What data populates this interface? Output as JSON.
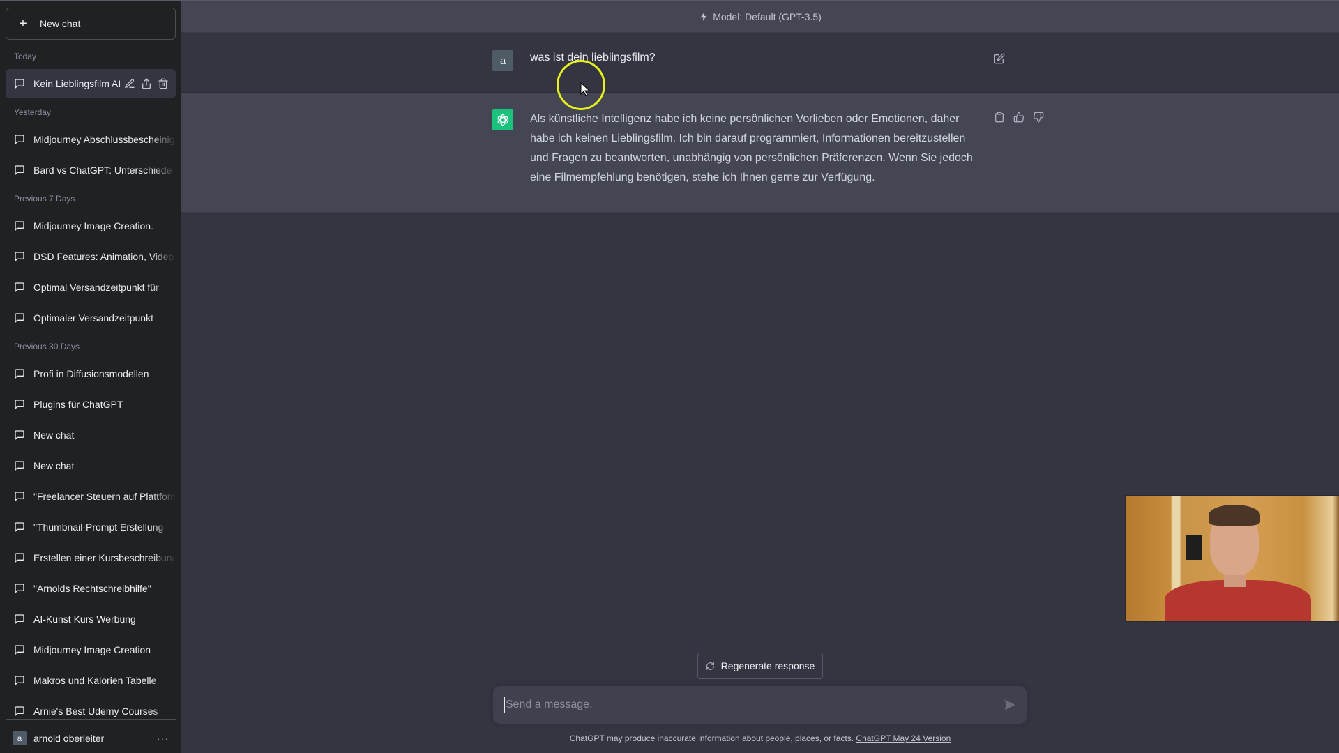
{
  "sidebar": {
    "new_chat_label": "New chat",
    "sections": {
      "today": "Today",
      "yesterday": "Yesterday",
      "prev7": "Previous 7 Days",
      "prev30": "Previous 30 Days"
    },
    "items": [
      {
        "label": "Kein Lieblingsfilm AI",
        "section": "Today",
        "active": true
      },
      {
        "label": "Midjourney Abschlussbescheinigung",
        "section": "Yesterday"
      },
      {
        "label": "Bard vs ChatGPT: Unterschiede",
        "section": "Yesterday"
      },
      {
        "label": "Midjourney Image Creation.",
        "section": "Previous 7 Days"
      },
      {
        "label": "DSD Features: Animation, Video",
        "section": "Previous 7 Days"
      },
      {
        "label": "Optimal Versandzeitpunkt für",
        "section": "Previous 7 Days"
      },
      {
        "label": "Optimaler Versandzeitpunkt",
        "section": "Previous 7 Days"
      },
      {
        "label": "Profi in Diffusionsmodellen",
        "section": "Previous 30 Days"
      },
      {
        "label": "Plugins für ChatGPT",
        "section": "Previous 30 Days"
      },
      {
        "label": "New chat",
        "section": "Previous 30 Days"
      },
      {
        "label": "New chat",
        "section": "Previous 30 Days"
      },
      {
        "label": "\"Freelancer Steuern auf Plattformen",
        "section": "Previous 30 Days"
      },
      {
        "label": "\"Thumbnail-Prompt Erstellung",
        "section": "Previous 30 Days"
      },
      {
        "label": "Erstellen einer Kursbeschreibung",
        "section": "Previous 30 Days"
      },
      {
        "label": "\"Arnolds Rechtschreibhilfe\"",
        "section": "Previous 30 Days"
      },
      {
        "label": "AI-Kunst Kurs Werbung",
        "section": "Previous 30 Days"
      },
      {
        "label": "Midjourney Image Creation",
        "section": "Previous 30 Days"
      },
      {
        "label": "Makros und Kalorien Tabelle",
        "section": "Previous 30 Days"
      },
      {
        "label": "Arnie's Best Udemy Courses",
        "section": "Previous 30 Days"
      }
    ],
    "user": {
      "initial": "a",
      "name": "arnold oberleiter",
      "menu": "···"
    }
  },
  "header": {
    "model_label": "Model: Default (GPT-3.5)"
  },
  "conversation": {
    "user_message": {
      "avatar": "a",
      "text": "was ist dein lieblingsfilm?"
    },
    "assistant_message": {
      "text": "Als künstliche Intelligenz habe ich keine persönlichen Vorlieben oder Emotionen, daher habe ich keinen Lieblingsfilm. Ich bin darauf programmiert, Informationen bereitzustellen und Fragen zu beantworten, unabhängig von persönlichen Präferenzen. Wenn Sie jedoch eine Filmempfehlung benötigen, stehe ich Ihnen gerne zur Verfügung."
    }
  },
  "composer": {
    "regenerate_label": "Regenerate response",
    "placeholder": "Send a message.",
    "value": ""
  },
  "footer": {
    "disclaimer": "ChatGPT may produce inaccurate information about people, places, or facts. ",
    "version_link": "ChatGPT May 24 Version"
  },
  "colors": {
    "sidebar_bg": "#202123",
    "main_bg": "#343541",
    "assistant_row_bg": "#444654",
    "gpt_avatar": "#19c37d",
    "user_avatar": "#4f5b66",
    "cursor_highlight": "#e6f21a"
  }
}
